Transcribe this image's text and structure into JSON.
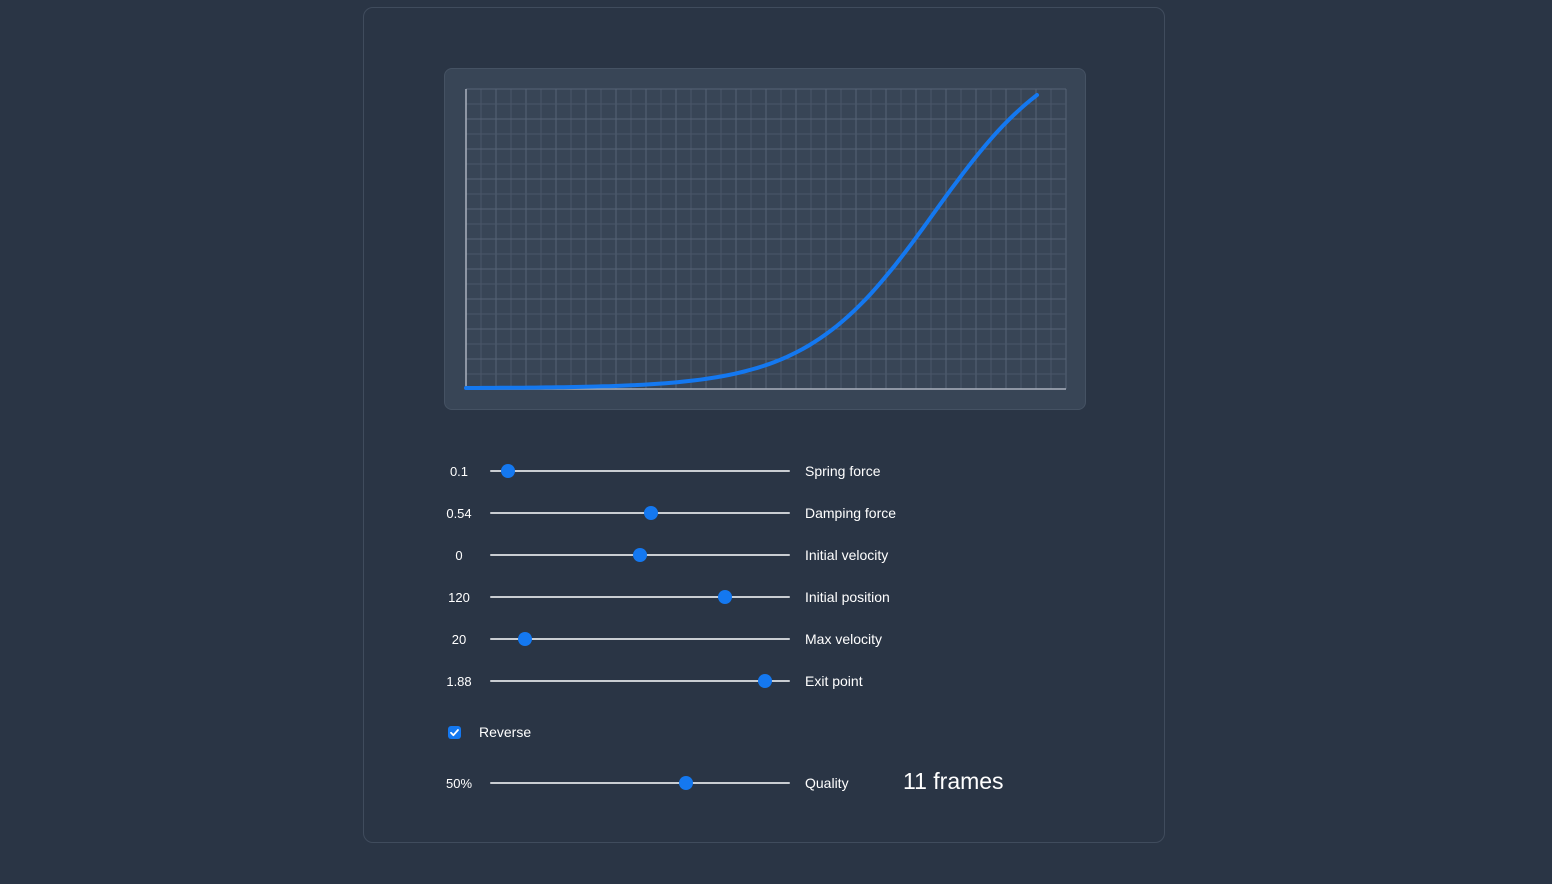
{
  "controls": [
    {
      "value": "0.1",
      "label": "Spring force",
      "position": 0.06
    },
    {
      "value": "0.54",
      "label": "Damping force",
      "position": 0.535
    },
    {
      "value": "0",
      "label": "Initial velocity",
      "position": 0.5
    },
    {
      "value": "120",
      "label": "Initial position",
      "position": 0.783
    },
    {
      "value": "20",
      "label": "Max velocity",
      "position": 0.117
    },
    {
      "value": "1.88",
      "label": "Exit point",
      "position": 0.917
    }
  ],
  "reverse": {
    "label": "Reverse",
    "checked": true
  },
  "quality": {
    "value": "50%",
    "label": "Quality",
    "position": 0.653
  },
  "frames_text": "11 frames",
  "colors": {
    "background": "#2a3545",
    "graph_background": "#384556",
    "accent": "#1478f0",
    "grid": "#536072"
  }
}
